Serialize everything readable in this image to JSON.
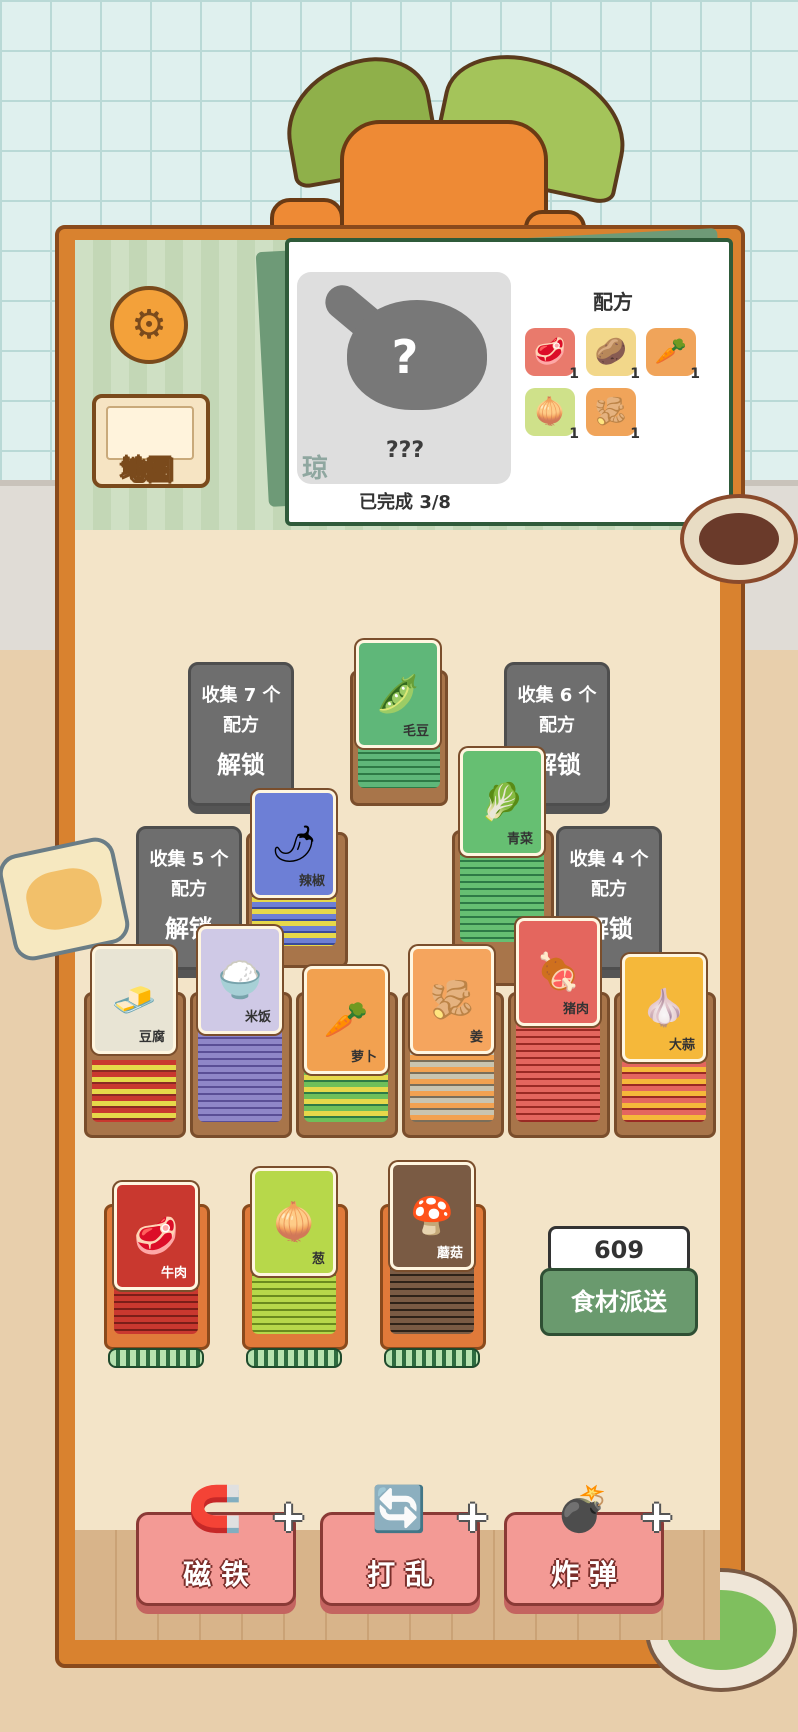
{
  "map_label": "地图",
  "recipe": {
    "title": "配方",
    "unknown_name": "???",
    "mystery_mark": "?",
    "stamp": "琼",
    "progress_text": "已完成 3/8",
    "ingredients": [
      {
        "icon": "🥩",
        "count": "1",
        "bg": "#e97a6c"
      },
      {
        "icon": "🥔",
        "count": "1",
        "bg": "#f2d78a"
      },
      {
        "icon": "🥕",
        "count": "1",
        "bg": "#f0a45a"
      },
      {
        "icon": "🧅",
        "count": "1",
        "bg": "#cfe18a"
      },
      {
        "icon": "🫚",
        "count": "1",
        "bg": "#f0a45a"
      }
    ]
  },
  "locked_cards": [
    {
      "line1": "收集 7 个",
      "line2": "配方",
      "line3": "解锁"
    },
    {
      "line1": "收集 6 个",
      "line2": "配方",
      "line3": "解锁"
    },
    {
      "line1": "收集 5 个",
      "line2": "配方",
      "line3": "解锁"
    },
    {
      "line1": "收集 4 个",
      "line2": "配方",
      "line3": "解锁"
    }
  ],
  "cards": {
    "edamame": {
      "label": "毛豆",
      "icon": "🫛",
      "color": "#5fb779"
    },
    "greens": {
      "label": "青菜",
      "icon": "🥬",
      "color": "#66bf72"
    },
    "chili": {
      "label": "辣椒",
      "icon": "🌶",
      "color": "#6d7fd6"
    },
    "tofu": {
      "label": "豆腐",
      "icon": "🧈",
      "color": "#e8e4d4"
    },
    "rice": {
      "label": "米饭",
      "icon": "🍚",
      "color": "#cfc9e6"
    },
    "radish": {
      "label": "萝卜",
      "icon": "🥕",
      "color": "#f2a150"
    },
    "ginger": {
      "label": "姜",
      "icon": "🫚",
      "color": "#f5a55e"
    },
    "pork": {
      "label": "猪肉",
      "icon": "🍖",
      "color": "#e4665e"
    },
    "garlic": {
      "label": "大蒜",
      "icon": "🧄",
      "color": "#f5b83a"
    },
    "beef": {
      "label": "牛肉",
      "icon": "🥩",
      "color": "#c9382f"
    },
    "scallion": {
      "label": "葱",
      "icon": "🧅",
      "color": "#b7d84a"
    },
    "mushroom": {
      "label": "蘑菇",
      "icon": "🍄",
      "color": "#7a5b44"
    }
  },
  "counter_value": "609",
  "dispatch_label": "食材派送",
  "tools": {
    "magnet": {
      "label": "磁 铁",
      "icon": "🧲"
    },
    "shuffle": {
      "label": "打 乱",
      "icon": "🔄"
    },
    "bomb": {
      "label": "炸 弹",
      "icon": "💣"
    },
    "plus": "+"
  }
}
